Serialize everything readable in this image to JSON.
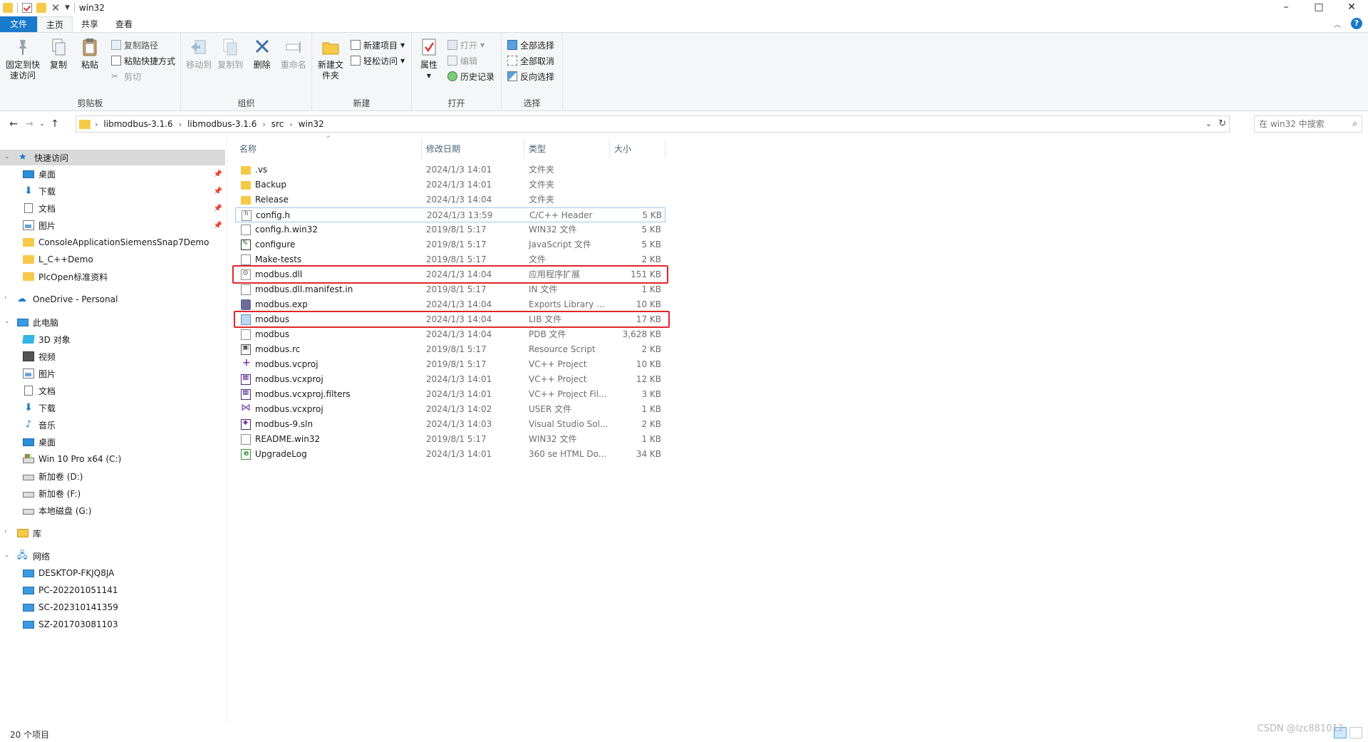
{
  "window": {
    "title": "win32",
    "controls": {
      "minimize": "–",
      "maximize": "□",
      "close": "✕"
    }
  },
  "tabs": {
    "file": "文件",
    "home": "主页",
    "share": "共享",
    "view": "查看"
  },
  "ribbon": {
    "clipboard": {
      "label": "剪贴板",
      "pin_quick": "固定到快速访问",
      "copy": "复制",
      "paste": "粘贴",
      "copy_path": "复制路径",
      "paste_shortcut": "粘贴快捷方式",
      "cut": "剪切"
    },
    "organize": {
      "label": "组织",
      "move_to": "移动到",
      "copy_to": "复制到",
      "delete": "删除",
      "rename": "重命名"
    },
    "new": {
      "label": "新建",
      "new_folder": "新建文件夹",
      "new_item": "新建项目",
      "easy_access": "轻松访问"
    },
    "open": {
      "label": "打开",
      "properties": "属性",
      "open": "打开",
      "edit": "编辑",
      "history": "历史记录"
    },
    "select": {
      "label": "选择",
      "select_all": "全部选择",
      "select_none": "全部取消",
      "invert": "反向选择"
    }
  },
  "address": {
    "crumbs": [
      "libmodbus-3.1.6",
      "libmodbus-3.1.6",
      "src",
      "win32"
    ],
    "search_placeholder": "在 win32 中搜索"
  },
  "nav": {
    "quick_access": "快速访问",
    "quick_items": [
      "桌面",
      "下载",
      "文档",
      "图片",
      "ConsoleApplicationSiemensSnap7Demo",
      "L_C++Demo",
      "PlcOpen标准资料"
    ],
    "onedrive": "OneDrive - Personal",
    "this_pc": "此电脑",
    "pc_items": [
      "3D 对象",
      "视频",
      "图片",
      "文档",
      "下载",
      "音乐",
      "桌面",
      "Win 10 Pro x64 (C:)",
      "新加卷 (D:)",
      "新加卷 (F:)",
      "本地磁盘 (G:)"
    ],
    "library": "库",
    "network": "网络",
    "network_items": [
      "DESKTOP-FKJQ8JA",
      "PC-202201051141",
      "SC-202310141359",
      "SZ-201703081103"
    ]
  },
  "columns": {
    "name": "名称",
    "date": "修改日期",
    "type": "类型",
    "size": "大小"
  },
  "files": [
    {
      "name": ".vs",
      "date": "2024/1/3 14:01",
      "type": "文件夹",
      "size": "",
      "icon": "folder-icon"
    },
    {
      "name": "Backup",
      "date": "2024/1/3 14:01",
      "type": "文件夹",
      "size": "",
      "icon": "folder-icon"
    },
    {
      "name": "Release",
      "date": "2024/1/3 14:04",
      "type": "文件夹",
      "size": "",
      "icon": "folder-icon"
    },
    {
      "name": "config.h",
      "date": "2024/1/3 13:59",
      "type": "C/C++ Header",
      "size": "5 KB",
      "icon": "header-file-icon"
    },
    {
      "name": "config.h.win32",
      "date": "2019/8/1 5:17",
      "type": "WIN32 文件",
      "size": "5 KB",
      "icon": "file-icon"
    },
    {
      "name": "configure",
      "date": "2019/8/1 5:17",
      "type": "JavaScript 文件",
      "size": "5 KB",
      "icon": "script-file-icon"
    },
    {
      "name": "Make-tests",
      "date": "2019/8/1 5:17",
      "type": "文件",
      "size": "2 KB",
      "icon": "file-icon"
    },
    {
      "name": "modbus.dll",
      "date": "2024/1/3 14:04",
      "type": "应用程序扩展",
      "size": "151 KB",
      "icon": "dll-file-icon"
    },
    {
      "name": "modbus.dll.manifest.in",
      "date": "2019/8/1 5:17",
      "type": "IN 文件",
      "size": "1 KB",
      "icon": "file-icon"
    },
    {
      "name": "modbus.exp",
      "date": "2024/1/3 14:04",
      "type": "Exports Library ...",
      "size": "10 KB",
      "icon": "exp-file-icon"
    },
    {
      "name": "modbus",
      "date": "2024/1/3 14:04",
      "type": "LIB 文件",
      "size": "17 KB",
      "icon": "lib-file-icon"
    },
    {
      "name": "modbus",
      "date": "2024/1/3 14:04",
      "type": "PDB 文件",
      "size": "3,628 KB",
      "icon": "file-icon"
    },
    {
      "name": "modbus.rc",
      "date": "2019/8/1 5:17",
      "type": "Resource Script",
      "size": "2 KB",
      "icon": "resource-file-icon"
    },
    {
      "name": "modbus.vcproj",
      "date": "2019/8/1 5:17",
      "type": "VC++ Project",
      "size": "10 KB",
      "icon": "vc-project-icon"
    },
    {
      "name": "modbus.vcxproj",
      "date": "2024/1/3 14:01",
      "type": "VC++ Project",
      "size": "12 KB",
      "icon": "vcx-project-icon"
    },
    {
      "name": "modbus.vcxproj.filters",
      "date": "2024/1/3 14:01",
      "type": "VC++ Project Fil...",
      "size": "3 KB",
      "icon": "vcx-project-icon"
    },
    {
      "name": "modbus.vcxproj",
      "date": "2024/1/3 14:02",
      "type": "USER 文件",
      "size": "1 KB",
      "icon": "visual-studio-icon"
    },
    {
      "name": "modbus-9.sln",
      "date": "2024/1/3 14:03",
      "type": "Visual Studio Sol...",
      "size": "2 KB",
      "icon": "solution-file-icon"
    },
    {
      "name": "README.win32",
      "date": "2019/8/1 5:17",
      "type": "WIN32 文件",
      "size": "1 KB",
      "icon": "file-icon"
    },
    {
      "name": "UpgradeLog",
      "date": "2024/1/3 14:01",
      "type": "360 se HTML Do...",
      "size": "34 KB",
      "icon": "html-file-icon"
    }
  ],
  "highlight_color": "#e0262a",
  "accent_color": "#1979ca",
  "status": {
    "count": "20 个项目"
  },
  "watermark": "CSDN @lzc881012"
}
